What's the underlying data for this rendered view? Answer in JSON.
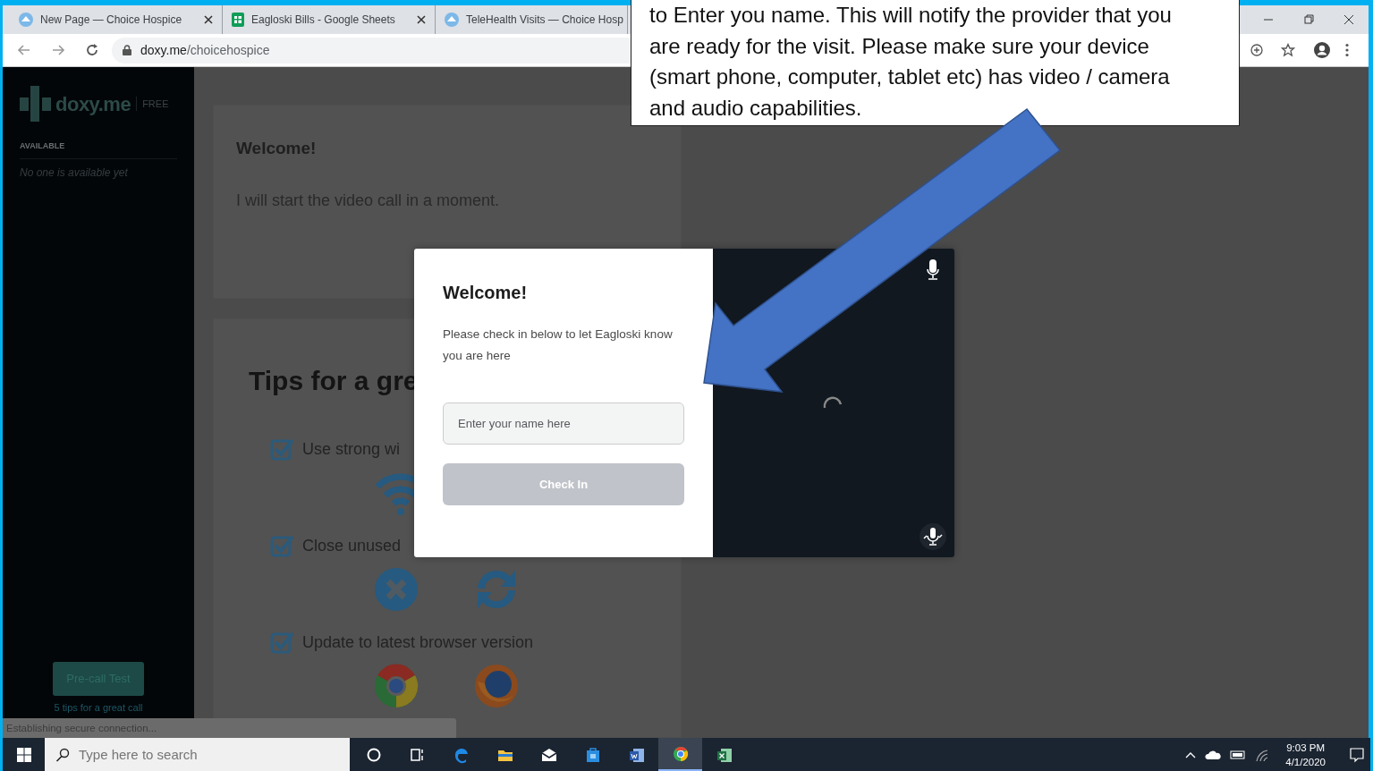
{
  "browser": {
    "tabs": [
      {
        "title": "New Page — Choice Hospice",
        "kind": "site"
      },
      {
        "title": "Eagloski Bills - Google Sheets",
        "kind": "sheets"
      },
      {
        "title": "TeleHealth Visits — Choice Hosp",
        "kind": "site"
      }
    ],
    "address": {
      "domain": "doxy.me",
      "path": "/choicehospice"
    }
  },
  "sidebar": {
    "logo": "doxy.me",
    "plan": "FREE",
    "section": "AVAILABLE",
    "empty_text": "No one is available yet",
    "button": "Pre-call Test",
    "link": "5 tips for a great call"
  },
  "welcome_card": {
    "title": "Welcome!",
    "message": "I will start the video call in a moment."
  },
  "tips_card": {
    "title": "Tips for a gre",
    "tips": [
      {
        "text": "Use strong wi",
        "checked": true,
        "icons": [
          {
            "kind": "wifi"
          }
        ]
      },
      {
        "text": "Close unused",
        "checked": true,
        "icons": [
          {
            "kind": "close"
          },
          {
            "kind": "refresh"
          }
        ]
      },
      {
        "text": "Update to latest browser version",
        "checked": true,
        "icons": [
          {
            "kind": "chrome"
          },
          {
            "kind": "firefox"
          }
        ]
      }
    ]
  },
  "modal": {
    "title": "Welcome!",
    "message": "Please check in below to let Eagloski know you are here",
    "placeholder": "Enter your name here",
    "button": "Check In",
    "button_disabled": true
  },
  "status_text": "Establishing secure connection...",
  "callout": {
    "text": "to Enter you name. This will notify the provider that you are ready for the visit. Please make sure your device (smart phone, computer, tablet etc) has video / camera and audio capabilities."
  },
  "taskbar": {
    "search_placeholder": "Type here to search",
    "apps": [
      {
        "kind": "cortana",
        "selected": false
      },
      {
        "kind": "taskview",
        "selected": false
      },
      {
        "kind": "edge",
        "selected": false
      },
      {
        "kind": "explorer",
        "selected": false
      },
      {
        "kind": "mail",
        "selected": false
      },
      {
        "kind": "store",
        "selected": false
      },
      {
        "kind": "word",
        "selected": false
      },
      {
        "kind": "chrome",
        "selected": true
      },
      {
        "kind": "excel",
        "selected": false
      }
    ],
    "time": "9:03 PM",
    "date": "4/1/2020"
  }
}
